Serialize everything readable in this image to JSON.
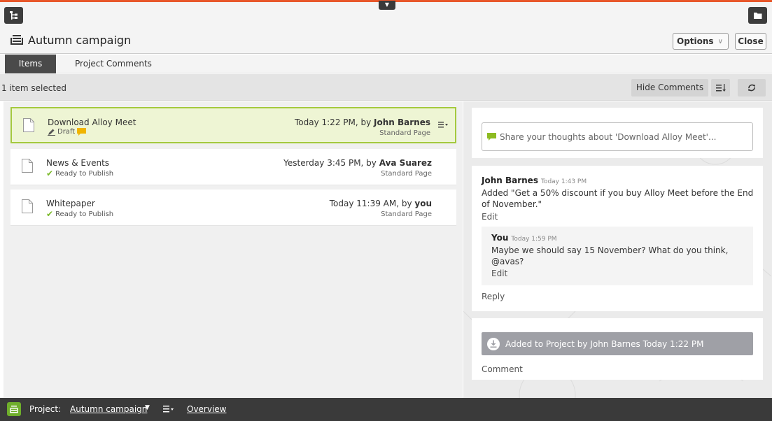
{
  "header": {
    "title": "Autumn campaign",
    "options_label": "Options",
    "close_label": "Close"
  },
  "tabs": [
    {
      "label": "Items",
      "active": true
    },
    {
      "label": "Project Comments",
      "active": false
    }
  ],
  "toolbar": {
    "selection_text": "1 item selected",
    "hide_comments_label": "Hide Comments"
  },
  "items": [
    {
      "name": "Download Alloy Meet",
      "status": "Draft",
      "time": "Today 1:22 PM, by ",
      "author": "John Barnes",
      "type": "Standard Page",
      "selected": true
    },
    {
      "name": "News & Events",
      "status": "Ready to Publish",
      "time": "Yesterday 3:45 PM, by ",
      "author": "Ava Suarez",
      "type": "Standard Page",
      "selected": false
    },
    {
      "name": "Whitepaper",
      "status": "Ready to Publish",
      "time": "Today 11:39 AM, by ",
      "author": "you",
      "type": "Standard Page",
      "selected": false
    }
  ],
  "comments": {
    "placeholder": "Share your thoughts about 'Download Alloy Meet'...",
    "thread": {
      "author": "John Barnes",
      "time": "Today 1:43 PM",
      "text": "Added \"Get a 50% discount if you buy Alloy Meet before the End of November.\"",
      "edit_label": "Edit",
      "reply": {
        "author": "You",
        "time": "Today 1:59 PM",
        "text": "Maybe we should say 15 November? What do you think, @avas?",
        "edit_label": "Edit"
      },
      "reply_label": "Reply"
    },
    "activity": {
      "text": "Added to Project by John Barnes Today 1:22 PM",
      "comment_label": "Comment"
    }
  },
  "footer": {
    "project_label": "Project:",
    "project_name": "Autumn campaign",
    "overview_label": "Overview"
  },
  "colors": {
    "accent_top": "#e8572a",
    "selected_bg": "#eef5d4",
    "selected_border": "#a4c93e",
    "check_green": "#7ab929",
    "comment_bubble": "#8dbb21",
    "activity_bg": "#9fa0a6",
    "footer_bg": "#3a3a3a"
  }
}
